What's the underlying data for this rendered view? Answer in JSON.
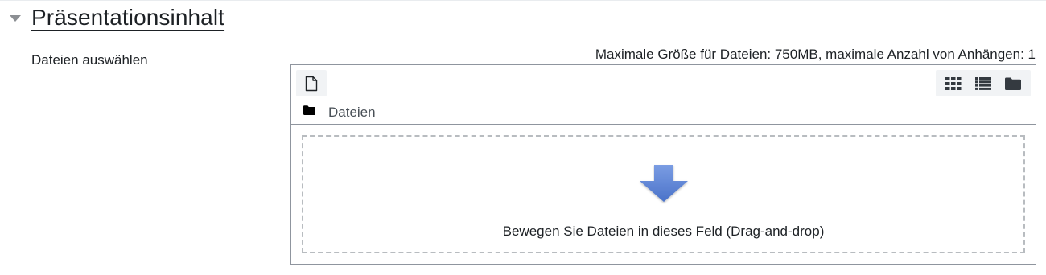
{
  "section": {
    "title": "Präsentationsinhalt",
    "toggle_icon": "caret-down-icon"
  },
  "field": {
    "label": "Dateien auswählen",
    "size_info": "Maximale Größe für Dateien: 750MB, maximale Anzahl von Anhängen: 1"
  },
  "filemanager": {
    "add_icon": "file-add-icon",
    "view_icons": [
      "grid-view-icon",
      "list-view-icon",
      "folder-view-icon"
    ],
    "path_icon": "folder-icon",
    "path_label": "Dateien",
    "dropzone_text": "Bewegen Sie Dateien in dieses Feld (Drag-and-drop)",
    "dropzone_icon": "arrow-down-icon",
    "arrow_color": "#5b84d6"
  }
}
